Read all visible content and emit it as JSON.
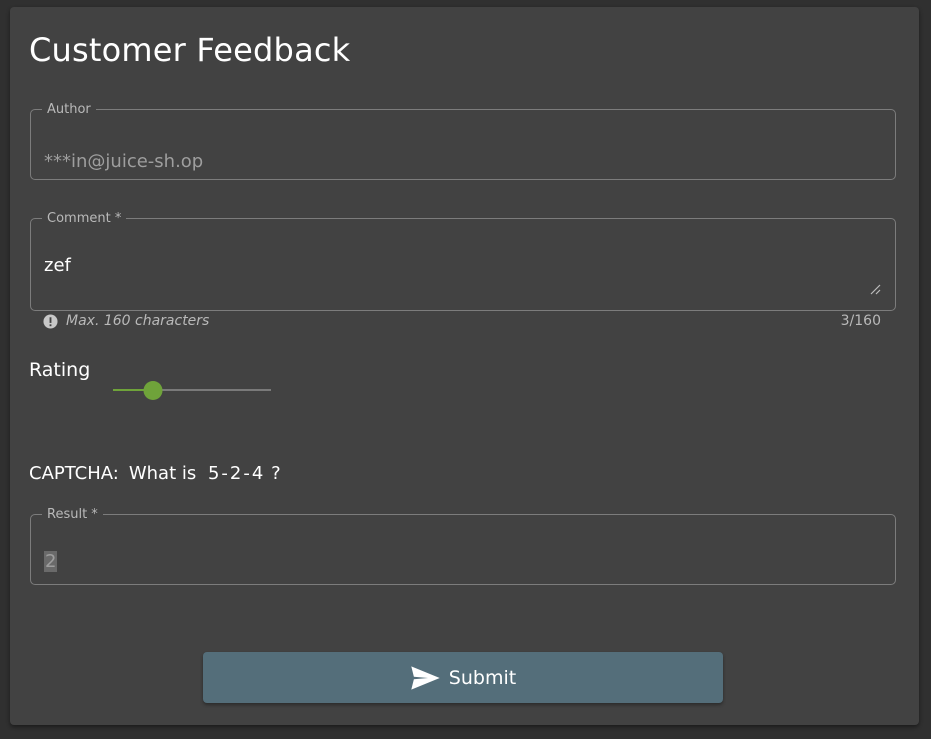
{
  "form": {
    "title": "Customer Feedback",
    "author": {
      "label": "Author",
      "value": "***in@juice-sh.op"
    },
    "comment": {
      "label": "Comment *",
      "value": "zef",
      "hint": "Max. 160 characters",
      "count": "3/160"
    },
    "rating": {
      "label": "Rating",
      "value": 2,
      "min": 1,
      "max": 5
    },
    "captcha": {
      "label": "CAPTCHA:",
      "question": "What is",
      "expression": "5-2-4",
      "suffix": "?"
    },
    "result": {
      "label": "Result *",
      "value": "2"
    },
    "submit_label": "Submit"
  },
  "icons": {
    "info": "exclamation-circle",
    "submit": "paper-plane-send",
    "resize": "resize-grip"
  },
  "colors": {
    "background": "#303030",
    "card": "#424242",
    "accent": "#6fa33a",
    "button": "#546e7a"
  }
}
